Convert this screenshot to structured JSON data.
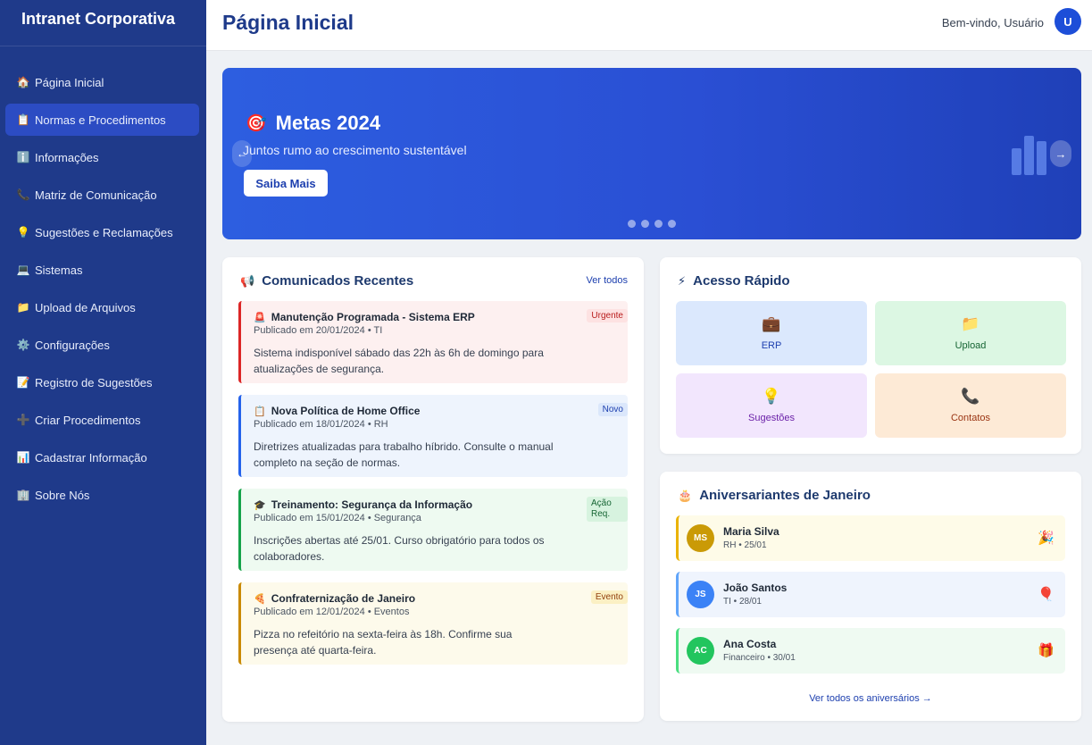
{
  "app": {
    "brand": "Intranet Corporativa",
    "page_title": "Página Inicial",
    "welcome": "Bem-vindo, Usuário",
    "avatar_initial": "U"
  },
  "sidebar": {
    "items": [
      {
        "icon": "🏠",
        "label": "Página Inicial"
      },
      {
        "icon": "📋",
        "label": "Normas e Procedimentos"
      },
      {
        "icon": "ℹ️",
        "label": "Informações"
      },
      {
        "icon": "📞",
        "label": "Matriz de Comunicação"
      },
      {
        "icon": "💡",
        "label": "Sugestões e Reclamações"
      },
      {
        "icon": "💻",
        "label": "Sistemas"
      },
      {
        "icon": "📁",
        "label": "Upload de Arquivos"
      },
      {
        "icon": "⚙️",
        "label": "Configurações"
      },
      {
        "icon": "📝",
        "label": "Registro de Sugestões"
      },
      {
        "icon": "➕",
        "label": "Criar Procedimentos"
      },
      {
        "icon": "📊",
        "label": "Cadastrar Informação"
      },
      {
        "icon": "🏢",
        "label": "Sobre Nós"
      }
    ]
  },
  "hero": {
    "icon": "🎯",
    "title": "Metas 2024",
    "subtitle": "Juntos rumo ao crescimento sustentável",
    "button": "Saiba Mais",
    "prev_glyph": "←",
    "next_glyph": "→",
    "slide_count": 4
  },
  "announcements": {
    "icon": "📢",
    "title": "Comunicados Recentes",
    "see_all": "Ver todos",
    "items": [
      {
        "icon": "🚨",
        "title": "Manutenção Programada - Sistema ERP",
        "meta": "Publicado em 20/01/2024 • TI",
        "body": "Sistema indisponível sábado das 22h às 6h de domingo para atualizações de segurança.",
        "badge": "Urgente"
      },
      {
        "icon": "📋",
        "title": "Nova Política de Home Office",
        "meta": "Publicado em 18/01/2024 • RH",
        "body": "Diretrizes atualizadas para trabalho híbrido. Consulte o manual completo na seção de normas.",
        "badge": "Novo"
      },
      {
        "icon": "🎓",
        "title": "Treinamento: Segurança da Informação",
        "meta": "Publicado em 15/01/2024 • Segurança",
        "body": "Inscrições abertas até 25/01. Curso obrigatório para todos os colaboradores.",
        "badge": "Ação Req."
      },
      {
        "icon": "🍕",
        "title": "Confraternização de Janeiro",
        "meta": "Publicado em 12/01/2024 • Eventos",
        "body": "Pizza no refeitório na sexta-feira às 18h. Confirme sua presença até quarta-feira.",
        "badge": "Evento"
      }
    ]
  },
  "quick_access": {
    "icon": "⚡",
    "title": "Acesso Rápido",
    "tiles": [
      {
        "icon": "💼",
        "label": "ERP"
      },
      {
        "icon": "📁",
        "label": "Upload"
      },
      {
        "icon": "💡",
        "label": "Sugestões"
      },
      {
        "icon": "📞",
        "label": "Contatos"
      }
    ]
  },
  "birthdays": {
    "icon": "🎂",
    "title": "Aniversariantes de Janeiro",
    "see_all": "Ver todos os aniversários →",
    "items": [
      {
        "initials": "MS",
        "name": "Maria Silva",
        "info": "RH • 25/01",
        "emoji": "🎉"
      },
      {
        "initials": "JS",
        "name": "João Santos",
        "info": "TI • 28/01",
        "emoji": "🎈"
      },
      {
        "initials": "AC",
        "name": "Ana Costa",
        "info": "Financeiro • 30/01",
        "emoji": "🎁"
      }
    ]
  },
  "colors": {
    "sidebar_bg": "#1f3a8a",
    "sidebar_active": "#2c4cc3",
    "accent": "#1e40af",
    "urgent": "#dc2626",
    "new": "#2563eb",
    "action": "#16a34a",
    "event": "#ca8a04"
  }
}
